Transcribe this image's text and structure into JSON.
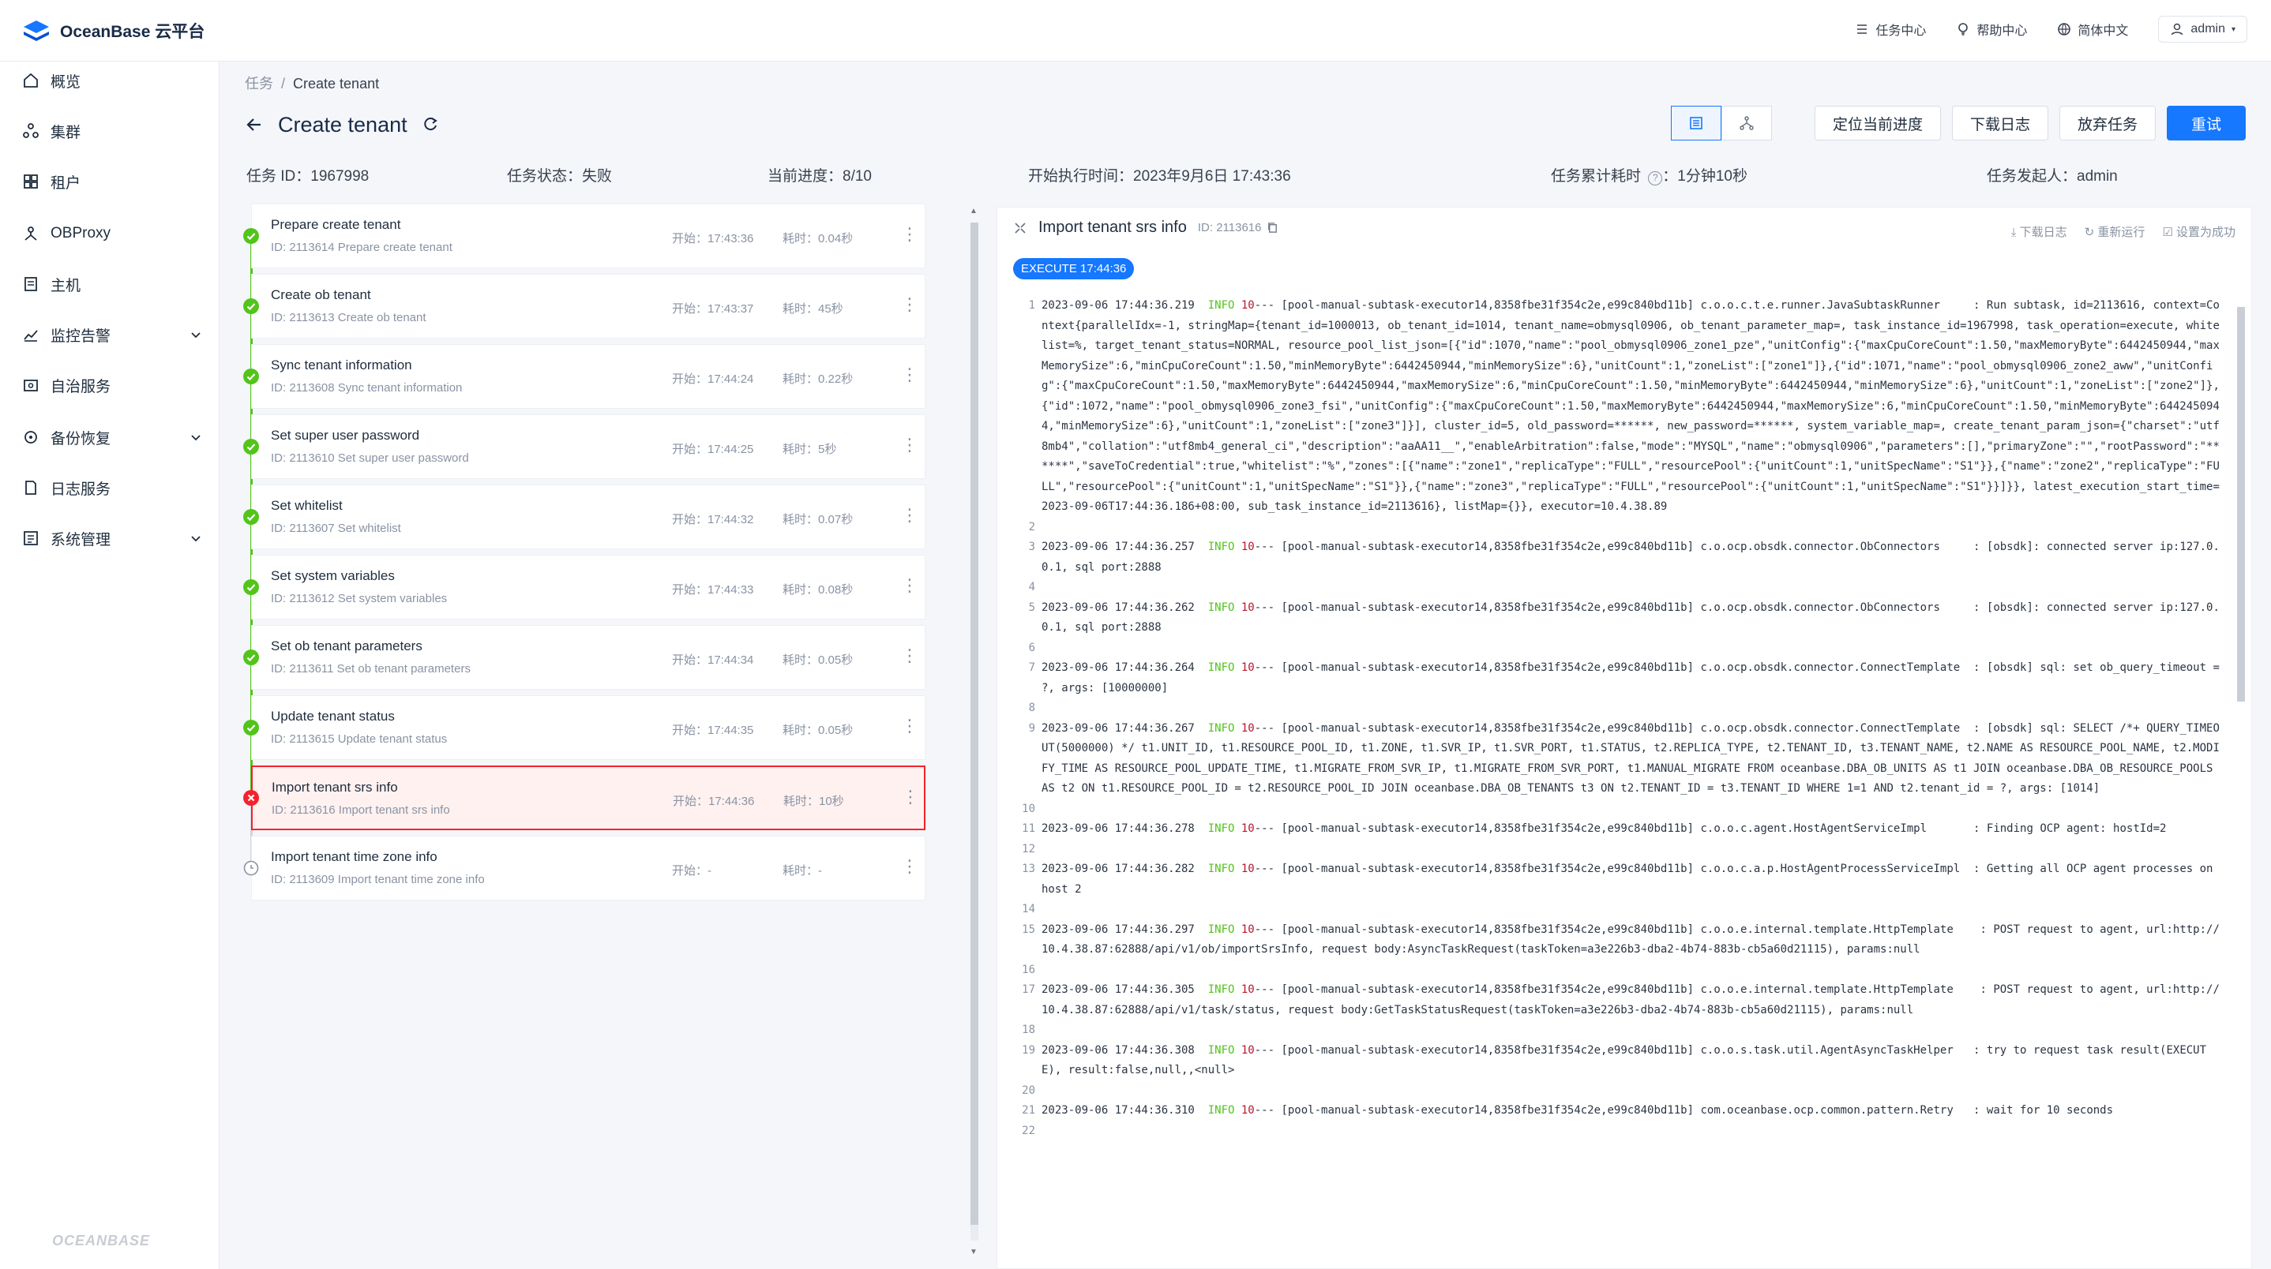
{
  "app": {
    "title": "OceanBase 云平台"
  },
  "topbar": {
    "task_center": "任务中心",
    "help_center": "帮助中心",
    "language": "简体中文",
    "user": "admin"
  },
  "sidebar": {
    "items": [
      {
        "label": "概览",
        "icon": "home-icon",
        "expandable": false
      },
      {
        "label": "集群",
        "icon": "cluster-icon",
        "expandable": false
      },
      {
        "label": "租户",
        "icon": "tenant-icon",
        "expandable": false
      },
      {
        "label": "OBProxy",
        "icon": "proxy-icon",
        "expandable": false
      },
      {
        "label": "主机",
        "icon": "host-icon",
        "expandable": false
      },
      {
        "label": "监控告警",
        "icon": "monitor-icon",
        "expandable": true
      },
      {
        "label": "自治服务",
        "icon": "autonomy-icon",
        "expandable": false
      },
      {
        "label": "备份恢复",
        "icon": "backup-icon",
        "expandable": true
      },
      {
        "label": "日志服务",
        "icon": "log-icon",
        "expandable": false
      },
      {
        "label": "系统管理",
        "icon": "system-icon",
        "expandable": true
      }
    ],
    "footer": "OCEANBASE"
  },
  "breadcrumb": {
    "parent": "任务",
    "sep": "/",
    "current": "Create tenant"
  },
  "page": {
    "title": "Create tenant"
  },
  "actions": {
    "locate_progress": "定位当前进度",
    "download_log": "下载日志",
    "abandon_task": "放弃任务",
    "retry": "重试"
  },
  "info": {
    "task_id": "任务 ID：1967998",
    "status": "任务状态：失败",
    "progress": "当前进度：8/10",
    "start_time": "开始执行时间：2023年9月6日 17:43:36",
    "elapsed_label": "任务累计耗时",
    "elapsed_value": "：1分钟10秒",
    "initiator": "任务发起人：admin"
  },
  "tasks": [
    {
      "name": "Prepare create tenant",
      "sub": "ID: 2113614   Prepare create tenant",
      "start": "开始：17:43:36",
      "dur": "耗时：0.04秒",
      "status": "success"
    },
    {
      "name": "Create ob tenant",
      "sub": "ID: 2113613   Create ob tenant",
      "start": "开始：17:43:37",
      "dur": "耗时：45秒",
      "status": "success"
    },
    {
      "name": "Sync tenant information",
      "sub": "ID: 2113608   Sync tenant information",
      "start": "开始：17:44:24",
      "dur": "耗时：0.22秒",
      "status": "success"
    },
    {
      "name": "Set super user password",
      "sub": "ID: 2113610   Set super user password",
      "start": "开始：17:44:25",
      "dur": "耗时：5秒",
      "status": "success"
    },
    {
      "name": "Set whitelist",
      "sub": "ID: 2113607   Set whitelist",
      "start": "开始：17:44:32",
      "dur": "耗时：0.07秒",
      "status": "success"
    },
    {
      "name": "Set system variables",
      "sub": "ID: 2113612   Set system variables",
      "start": "开始：17:44:33",
      "dur": "耗时：0.08秒",
      "status": "success"
    },
    {
      "name": "Set ob tenant parameters",
      "sub": "ID: 2113611   Set ob tenant parameters",
      "start": "开始：17:44:34",
      "dur": "耗时：0.05秒",
      "status": "success"
    },
    {
      "name": "Update tenant status",
      "sub": "ID: 2113615   Update tenant status",
      "start": "开始：17:44:35",
      "dur": "耗时：0.05秒",
      "status": "success"
    },
    {
      "name": "Import tenant srs info",
      "sub": "ID: 2113616   Import tenant srs info",
      "start": "开始：17:44:36",
      "dur": "耗时：10秒",
      "status": "failed"
    },
    {
      "name": "Import tenant time zone info",
      "sub": "ID: 2113609   Import tenant time zone info",
      "start": "开始：-",
      "dur": "耗时：-",
      "status": "pending"
    }
  ],
  "log": {
    "title": "Import tenant srs info",
    "id": "ID: 2113616",
    "tools": {
      "download": "下载日志",
      "rerun": "重新运行",
      "set_success": "设置为成功"
    },
    "exec_tag": "EXECUTE 17:44:36",
    "lines": [
      {
        "n": "1",
        "t": "2023-09-06 17:44:36.219  INFO 10 --- [pool-manual-subtask-executor14,8358fbe31f354c2e,e99c840bd11b] c.o.o.c.t.e.runner.JavaSubtaskRunner     : Run subtask, id=2113616, context=Context{parallelIdx=-1, stringMap={tenant_id=1000013, ob_tenant_id=1014, tenant_name=obmysql0906, ob_tenant_parameter_map=, task_instance_id=1967998, task_operation=execute, whitelist=%, target_tenant_status=NORMAL, resource_pool_list_json=[{\"id\":1070,\"name\":\"pool_obmysql0906_zone1_pze\",\"unitConfig\":{\"maxCpuCoreCount\":1.50,\"maxMemoryByte\":6442450944,\"maxMemorySize\":6,\"minCpuCoreCount\":1.50,\"minMemoryByte\":6442450944,\"minMemorySize\":6},\"unitCount\":1,\"zoneList\":[\"zone1\"]},{\"id\":1071,\"name\":\"pool_obmysql0906_zone2_aww\",\"unitConfig\":{\"maxCpuCoreCount\":1.50,\"maxMemoryByte\":6442450944,\"maxMemorySize\":6,\"minCpuCoreCount\":1.50,\"minMemoryByte\":6442450944,\"minMemorySize\":6},\"unitCount\":1,\"zoneList\":[\"zone2\"]},{\"id\":1072,\"name\":\"pool_obmysql0906_zone3_fsi\",\"unitConfig\":{\"maxCpuCoreCount\":1.50,\"maxMemoryByte\":6442450944,\"maxMemorySize\":6,\"minCpuCoreCount\":1.50,\"minMemoryByte\":6442450944,\"minMemorySize\":6},\"unitCount\":1,\"zoneList\":[\"zone3\"]}], cluster_id=5, old_password=******, new_password=******, system_variable_map=, create_tenant_param_json={\"charset\":\"utf8mb4\",\"collation\":\"utf8mb4_general_ci\",\"description\":\"aaAA11__\",\"enableArbitration\":false,\"mode\":\"MYSQL\",\"name\":\"obmysql0906\",\"parameters\":[],\"primaryZone\":\"\",\"rootPassword\":\"******\",\"saveToCredential\":true,\"whitelist\":\"%\",\"zones\":[{\"name\":\"zone1\",\"replicaType\":\"FULL\",\"resourcePool\":{\"unitCount\":1,\"unitSpecName\":\"S1\"}},{\"name\":\"zone2\",\"replicaType\":\"FULL\",\"resourcePool\":{\"unitCount\":1,\"unitSpecName\":\"S1\"}},{\"name\":\"zone3\",\"replicaType\":\"FULL\",\"resourcePool\":{\"unitCount\":1,\"unitSpecName\":\"S1\"}}]}}, latest_execution_start_time=2023-09-06T17:44:36.186+08:00, sub_task_instance_id=2113616}, listMap={}}, executor=10.4.38.89"
      },
      {
        "n": "2",
        "t": ""
      },
      {
        "n": "3",
        "t": "2023-09-06 17:44:36.257  INFO 10 --- [pool-manual-subtask-executor14,8358fbe31f354c2e,e99c840bd11b] c.o.ocp.obsdk.connector.ObConnectors     : [obsdk]: connected server ip:127.0.0.1, sql port:2888"
      },
      {
        "n": "4",
        "t": ""
      },
      {
        "n": "5",
        "t": "2023-09-06 17:44:36.262  INFO 10 --- [pool-manual-subtask-executor14,8358fbe31f354c2e,e99c840bd11b] c.o.ocp.obsdk.connector.ObConnectors     : [obsdk]: connected server ip:127.0.0.1, sql port:2888"
      },
      {
        "n": "6",
        "t": ""
      },
      {
        "n": "7",
        "t": "2023-09-06 17:44:36.264  INFO 10 --- [pool-manual-subtask-executor14,8358fbe31f354c2e,e99c840bd11b] c.o.ocp.obsdk.connector.ConnectTemplate  : [obsdk] sql: set ob_query_timeout = ?, args: [10000000]"
      },
      {
        "n": "8",
        "t": ""
      },
      {
        "n": "9",
        "t": "2023-09-06 17:44:36.267  INFO 10 --- [pool-manual-subtask-executor14,8358fbe31f354c2e,e99c840bd11b] c.o.ocp.obsdk.connector.ConnectTemplate  : [obsdk] sql: SELECT /*+ QUERY_TIMEOUT(5000000) */ t1.UNIT_ID, t1.RESOURCE_POOL_ID, t1.ZONE, t1.SVR_IP, t1.SVR_PORT, t1.STATUS, t2.REPLICA_TYPE, t2.TENANT_ID, t3.TENANT_NAME, t2.NAME AS RESOURCE_POOL_NAME, t2.MODIFY_TIME AS RESOURCE_POOL_UPDATE_TIME, t1.MIGRATE_FROM_SVR_IP, t1.MIGRATE_FROM_SVR_PORT, t1.MANUAL_MIGRATE FROM oceanbase.DBA_OB_UNITS AS t1 JOIN oceanbase.DBA_OB_RESOURCE_POOLS AS t2 ON t1.RESOURCE_POOL_ID = t2.RESOURCE_POOL_ID JOIN oceanbase.DBA_OB_TENANTS t3 ON t2.TENANT_ID = t3.TENANT_ID WHERE 1=1 AND t2.tenant_id = ?, args: [1014]"
      },
      {
        "n": "10",
        "t": ""
      },
      {
        "n": "11",
        "t": "2023-09-06 17:44:36.278  INFO 10 --- [pool-manual-subtask-executor14,8358fbe31f354c2e,e99c840bd11b] c.o.o.c.agent.HostAgentServiceImpl       : Finding OCP agent: hostId=2"
      },
      {
        "n": "12",
        "t": ""
      },
      {
        "n": "13",
        "t": "2023-09-06 17:44:36.282  INFO 10 --- [pool-manual-subtask-executor14,8358fbe31f354c2e,e99c840bd11b] c.o.o.c.a.p.HostAgentProcessServiceImpl  : Getting all OCP agent processes on host 2"
      },
      {
        "n": "14",
        "t": ""
      },
      {
        "n": "15",
        "t": "2023-09-06 17:44:36.297  INFO 10 --- [pool-manual-subtask-executor14,8358fbe31f354c2e,e99c840bd11b] c.o.o.e.internal.template.HttpTemplate    : POST request to agent, url:http://10.4.38.87:62888/api/v1/ob/importSrsInfo, request body:AsyncTaskRequest(taskToken=a3e226b3-dba2-4b74-883b-cb5a60d21115), params:null"
      },
      {
        "n": "16",
        "t": ""
      },
      {
        "n": "17",
        "t": "2023-09-06 17:44:36.305  INFO 10 --- [pool-manual-subtask-executor14,8358fbe31f354c2e,e99c840bd11b] c.o.o.e.internal.template.HttpTemplate    : POST request to agent, url:http://10.4.38.87:62888/api/v1/task/status, request body:GetTaskStatusRequest(taskToken=a3e226b3-dba2-4b74-883b-cb5a60d21115), params:null"
      },
      {
        "n": "18",
        "t": ""
      },
      {
        "n": "19",
        "t": "2023-09-06 17:44:36.308  INFO 10 --- [pool-manual-subtask-executor14,8358fbe31f354c2e,e99c840bd11b] c.o.o.s.task.util.AgentAsyncTaskHelper   : try to request task result(EXECUTE), result:false,null,,<null>"
      },
      {
        "n": "20",
        "t": ""
      },
      {
        "n": "21",
        "t": "2023-09-06 17:44:36.310  INFO 10 --- [pool-manual-subtask-executor14,8358fbe31f354c2e,e99c840bd11b] com.oceanbase.ocp.common.pattern.Retry   : wait for 10 seconds"
      },
      {
        "n": "22",
        "t": ""
      }
    ]
  },
  "colors": {
    "primary": "#1677ff",
    "success": "#52c41a",
    "error": "#f5222d",
    "pending": "#8a93a3"
  }
}
